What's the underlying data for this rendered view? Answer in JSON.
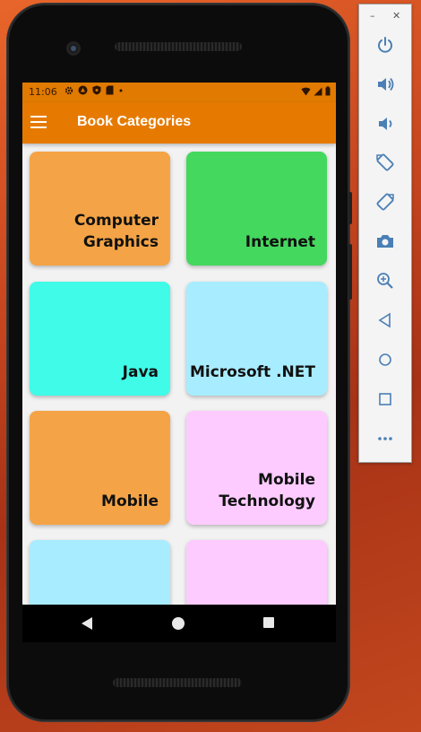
{
  "status_bar": {
    "time": "11:06"
  },
  "app_bar": {
    "title": "Book Categories"
  },
  "categories": [
    {
      "label": "Computer\nGraphics",
      "color": "#f4a446"
    },
    {
      "label": "Internet",
      "color": "#44d85e"
    },
    {
      "label": "Java",
      "color": "#40fbe8"
    },
    {
      "label": "Microsoft .NET",
      "color": "#a8ecff"
    },
    {
      "label": "Mobile",
      "color": "#f4a446"
    },
    {
      "label": "Mobile\nTechnology",
      "color": "#fdcbff"
    },
    {
      "label": "",
      "color": "#a8ecff"
    },
    {
      "label": "",
      "color": "#fdcbff"
    }
  ],
  "emulator_panel": {
    "minimize": "–",
    "close": "✕",
    "tools": [
      "power-icon",
      "volume-up-icon",
      "volume-down-icon",
      "rotate-left-icon",
      "rotate-right-icon",
      "camera-icon",
      "zoom-icon",
      "back-icon",
      "home-icon",
      "overview-icon",
      "more-icon"
    ]
  },
  "colors": {
    "app_bar": "#e67a00",
    "status_bar": "#e07a00",
    "screen_bg": "#f2f2f2"
  }
}
